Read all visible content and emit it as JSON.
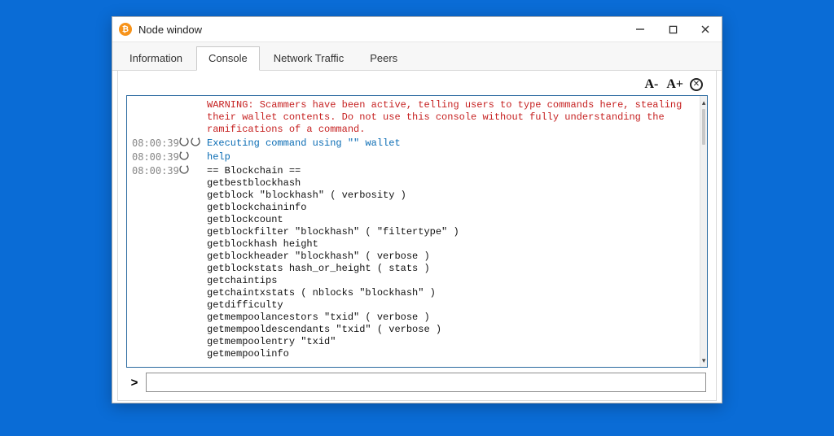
{
  "window": {
    "title": "Node window"
  },
  "tabs": [
    {
      "label": "Information",
      "active": false
    },
    {
      "label": "Console",
      "active": true
    },
    {
      "label": "Network Traffic",
      "active": false
    },
    {
      "label": "Peers",
      "active": false
    }
  ],
  "toolbar": {
    "font_smaller": "A-",
    "font_larger": "A+",
    "clear_symbol": "✕"
  },
  "console": {
    "warning_text": "WARNING: Scammers have been active, telling users to type commands here, stealing their wallet contents. Do not use this console without fully understanding the ramifications of a command.",
    "entries": [
      {
        "ts": "08:00:39",
        "kind": "exec",
        "text": "Executing command using \"\" wallet"
      },
      {
        "ts": "08:00:39",
        "kind": "sent",
        "text": "help"
      },
      {
        "ts": "08:00:39",
        "kind": "recv",
        "text": "== Blockchain ==\ngetbestblockhash\ngetblock \"blockhash\" ( verbosity )\ngetblockchaininfo\ngetblockcount\ngetblockfilter \"blockhash\" ( \"filtertype\" )\ngetblockhash height\ngetblockheader \"blockhash\" ( verbose )\ngetblockstats hash_or_height ( stats )\ngetchaintips\ngetchaintxstats ( nblocks \"blockhash\" )\ngetdifficulty\ngetmempoolancestors \"txid\" ( verbose )\ngetmempooldescendants \"txid\" ( verbose )\ngetmempoolentry \"txid\"\ngetmempoolinfo"
      }
    ]
  },
  "input": {
    "prompt_glyph": ">",
    "value": "",
    "placeholder": ""
  }
}
